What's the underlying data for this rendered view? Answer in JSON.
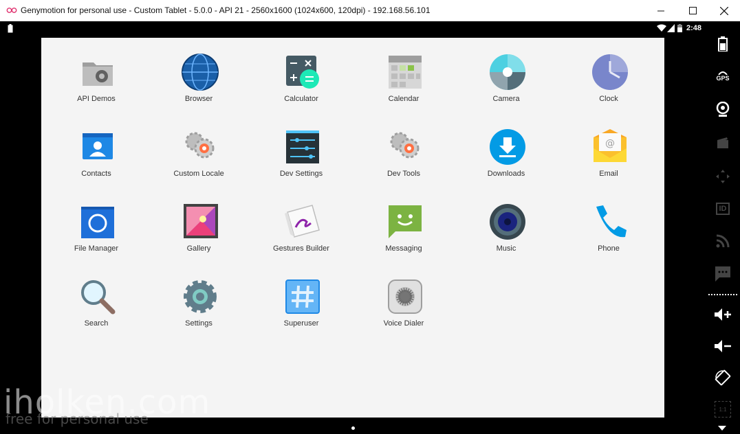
{
  "window": {
    "title": "Genymotion for personal use - Custom Tablet - 5.0.0 - API 21 - 2560x1600 (1024x600, 120dpi) - 192.168.56.101",
    "icon": "genymotion-logo-icon",
    "controls": [
      "minimize-icon",
      "maximize-icon",
      "close-icon"
    ]
  },
  "statusbar": {
    "time": "2:48",
    "icons": [
      "battery-icon",
      "wifi-icon",
      "signal-icon"
    ]
  },
  "apps": [
    {
      "label": "API Demos",
      "icon": "folder-gear-icon"
    },
    {
      "label": "Browser",
      "icon": "globe-icon"
    },
    {
      "label": "Calculator",
      "icon": "calculator-icon"
    },
    {
      "label": "Calendar",
      "icon": "calendar-icon"
    },
    {
      "label": "Camera",
      "icon": "camera-aperture-icon"
    },
    {
      "label": "Clock",
      "icon": "clock-icon"
    },
    {
      "label": "Contacts",
      "icon": "contacts-icon"
    },
    {
      "label": "Custom Locale",
      "icon": "gears-icon"
    },
    {
      "label": "Dev Settings",
      "icon": "sliders-icon"
    },
    {
      "label": "Dev Tools",
      "icon": "gears-icon"
    },
    {
      "label": "Downloads",
      "icon": "download-icon"
    },
    {
      "label": "Email",
      "icon": "envelope-icon"
    },
    {
      "label": "File Manager",
      "icon": "file-manager-icon"
    },
    {
      "label": "Gallery",
      "icon": "picture-frame-icon"
    },
    {
      "label": "Gestures Builder",
      "icon": "gesture-icon"
    },
    {
      "label": "Messaging",
      "icon": "message-smile-icon"
    },
    {
      "label": "Music",
      "icon": "speaker-icon"
    },
    {
      "label": "Phone",
      "icon": "phone-icon"
    },
    {
      "label": "Search",
      "icon": "magnifier-icon"
    },
    {
      "label": "Settings",
      "icon": "gear-icon"
    },
    {
      "label": "Superuser",
      "icon": "hash-icon"
    },
    {
      "label": "Voice Dialer",
      "icon": "voice-dialer-icon"
    }
  ],
  "sidebar": {
    "items": [
      "battery-icon",
      "gps-icon",
      "webcam-icon",
      "media-icon",
      "dpad-icon",
      "id-icon",
      "rss-icon",
      "sms-icon",
      "volume-up-icon",
      "volume-down-icon",
      "rotate-icon",
      "scale-icon"
    ],
    "gps_label": "GPS",
    "id_label": "ID",
    "scale_label": "1:1"
  },
  "watermark": {
    "text": "iholken.com",
    "sub": "free for personal use"
  },
  "colors": {
    "drawer_bg": "#f4f4f4",
    "chrome_bg": "#000000"
  }
}
